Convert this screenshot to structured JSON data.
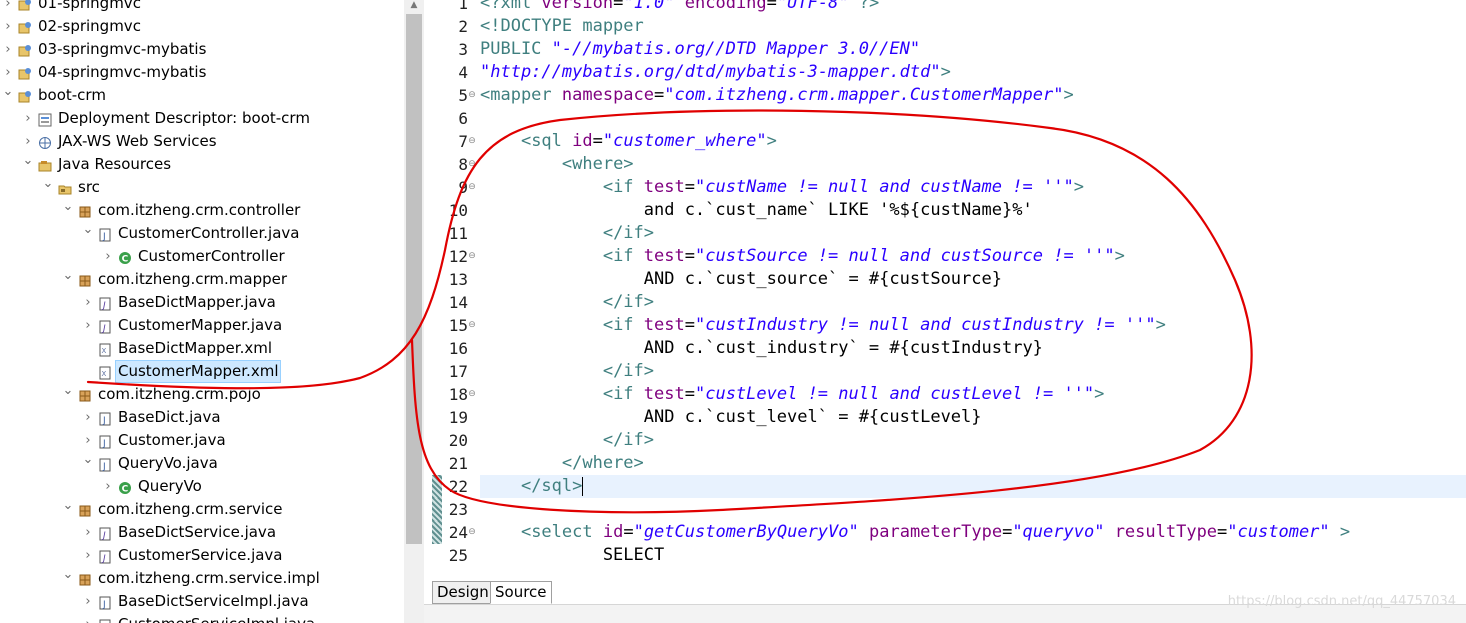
{
  "explorer": {
    "items": [
      {
        "label": "01-springmvc",
        "level": 0,
        "arrow": "collapsed",
        "icon": "web-project-icon"
      },
      {
        "label": "02-springmvc",
        "level": 0,
        "arrow": "collapsed",
        "icon": "web-project-icon"
      },
      {
        "label": "03-springmvc-mybatis",
        "level": 0,
        "arrow": "collapsed",
        "icon": "web-project-icon"
      },
      {
        "label": "04-springmvc-mybatis",
        "level": 0,
        "arrow": "collapsed",
        "icon": "web-project-icon"
      },
      {
        "label": "boot-crm",
        "level": 0,
        "arrow": "expanded",
        "icon": "web-project-icon"
      },
      {
        "label": "Deployment Descriptor: boot-crm",
        "level": 1,
        "arrow": "collapsed",
        "icon": "deployment-descriptor-icon"
      },
      {
        "label": "JAX-WS Web Services",
        "level": 1,
        "arrow": "collapsed",
        "icon": "web-services-icon"
      },
      {
        "label": "Java Resources",
        "level": 1,
        "arrow": "expanded",
        "icon": "java-resources-icon"
      },
      {
        "label": "src",
        "level": 2,
        "arrow": "expanded",
        "icon": "source-folder-icon"
      },
      {
        "label": "com.itzheng.crm.controller",
        "level": 3,
        "arrow": "expanded",
        "icon": "package-icon"
      },
      {
        "label": "CustomerController.java",
        "level": 4,
        "arrow": "expanded",
        "icon": "java-file-icon"
      },
      {
        "label": "CustomerController",
        "level": 5,
        "arrow": "collapsed",
        "icon": "class-icon"
      },
      {
        "label": "com.itzheng.crm.mapper",
        "level": 3,
        "arrow": "expanded",
        "icon": "package-icon"
      },
      {
        "label": "BaseDictMapper.java",
        "level": 4,
        "arrow": "collapsed",
        "icon": "java-interface-file-icon"
      },
      {
        "label": "CustomerMapper.java",
        "level": 4,
        "arrow": "collapsed",
        "icon": "java-interface-file-icon"
      },
      {
        "label": "BaseDictMapper.xml",
        "level": 4,
        "arrow": "none",
        "icon": "xml-file-icon"
      },
      {
        "label": "CustomerMapper.xml",
        "level": 4,
        "arrow": "none",
        "icon": "xml-file-icon",
        "selected": true
      },
      {
        "label": "com.itzheng.crm.pojo",
        "level": 3,
        "arrow": "expanded",
        "icon": "package-icon"
      },
      {
        "label": "BaseDict.java",
        "level": 4,
        "arrow": "collapsed",
        "icon": "java-file-icon"
      },
      {
        "label": "Customer.java",
        "level": 4,
        "arrow": "collapsed",
        "icon": "java-file-icon"
      },
      {
        "label": "QueryVo.java",
        "level": 4,
        "arrow": "expanded",
        "icon": "java-file-icon"
      },
      {
        "label": "QueryVo",
        "level": 5,
        "arrow": "collapsed",
        "icon": "class-icon"
      },
      {
        "label": "com.itzheng.crm.service",
        "level": 3,
        "arrow": "expanded",
        "icon": "package-icon"
      },
      {
        "label": "BaseDictService.java",
        "level": 4,
        "arrow": "collapsed",
        "icon": "java-interface-file-icon"
      },
      {
        "label": "CustomerService.java",
        "level": 4,
        "arrow": "collapsed",
        "icon": "java-interface-file-icon"
      },
      {
        "label": "com.itzheng.crm.service.impl",
        "level": 3,
        "arrow": "expanded",
        "icon": "package-icon"
      },
      {
        "label": "BaseDictServiceImpl.java",
        "level": 4,
        "arrow": "collapsed",
        "icon": "java-file-icon"
      },
      {
        "label": "CustomerServiceImpl.java",
        "level": 4,
        "arrow": "collapsed",
        "icon": "java-file-icon"
      }
    ]
  },
  "editor": {
    "current_line": 22,
    "annotated_lines": [
      22,
      23,
      24
    ],
    "lines": [
      {
        "num": "1",
        "fold": "",
        "tokens": [
          [
            "c-pi",
            "<?xml "
          ],
          [
            "c-attr",
            "version"
          ],
          [
            "c-plain",
            "="
          ],
          [
            "c-str",
            "\"1.0\""
          ],
          [
            "c-plain",
            " "
          ],
          [
            "c-attr",
            "encoding"
          ],
          [
            "c-plain",
            "="
          ],
          [
            "c-str",
            "\"UTF-8\""
          ],
          [
            "c-pi",
            " ?>"
          ]
        ]
      },
      {
        "num": "2",
        "fold": "",
        "tokens": [
          [
            "c-dt",
            "<!DOCTYPE mapper"
          ]
        ]
      },
      {
        "num": "3",
        "fold": "",
        "tokens": [
          [
            "c-dt",
            "PUBLIC "
          ],
          [
            "c-str",
            "\"-//mybatis.org//DTD Mapper 3.0//EN\""
          ]
        ]
      },
      {
        "num": "4",
        "fold": "",
        "tokens": [
          [
            "c-str",
            "\"http://mybatis.org/dtd/mybatis-3-mapper.dtd\""
          ],
          [
            "c-dt",
            ">"
          ]
        ]
      },
      {
        "num": "5",
        "fold": "⊖",
        "tokens": [
          [
            "c-tag",
            "<mapper "
          ],
          [
            "c-attr",
            "namespace"
          ],
          [
            "c-plain",
            "="
          ],
          [
            "c-str",
            "\"com.itzheng.crm.mapper.CustomerMapper\""
          ],
          [
            "c-tag",
            ">"
          ]
        ]
      },
      {
        "num": "6",
        "fold": "",
        "tokens": []
      },
      {
        "num": "7",
        "fold": "⊖",
        "tokens": [
          [
            "c-plain",
            "    "
          ],
          [
            "c-tag",
            "<sql "
          ],
          [
            "c-attr",
            "id"
          ],
          [
            "c-plain",
            "="
          ],
          [
            "c-str",
            "\"customer_where\""
          ],
          [
            "c-tag",
            ">"
          ]
        ]
      },
      {
        "num": "8",
        "fold": "⊖",
        "tokens": [
          [
            "c-plain",
            "        "
          ],
          [
            "c-tag",
            "<where>"
          ]
        ]
      },
      {
        "num": "9",
        "fold": "⊖",
        "tokens": [
          [
            "c-plain",
            "            "
          ],
          [
            "c-tag",
            "<if "
          ],
          [
            "c-attr",
            "test"
          ],
          [
            "c-plain",
            "="
          ],
          [
            "c-str",
            "\"custName != null and custName != ''\""
          ],
          [
            "c-tag",
            ">"
          ]
        ]
      },
      {
        "num": "10",
        "fold": "",
        "tokens": [
          [
            "c-text",
            "                and c.`cust_name` LIKE '%${custName}%'"
          ]
        ]
      },
      {
        "num": "11",
        "fold": "",
        "tokens": [
          [
            "c-plain",
            "            "
          ],
          [
            "c-tag",
            "</if>"
          ]
        ]
      },
      {
        "num": "12",
        "fold": "⊖",
        "tokens": [
          [
            "c-plain",
            "            "
          ],
          [
            "c-tag",
            "<if "
          ],
          [
            "c-attr",
            "test"
          ],
          [
            "c-plain",
            "="
          ],
          [
            "c-str",
            "\"custSource != null and custSource != ''\""
          ],
          [
            "c-tag",
            ">"
          ]
        ]
      },
      {
        "num": "13",
        "fold": "",
        "tokens": [
          [
            "c-text",
            "                AND c.`cust_source` = #{custSource}"
          ]
        ]
      },
      {
        "num": "14",
        "fold": "",
        "tokens": [
          [
            "c-plain",
            "            "
          ],
          [
            "c-tag",
            "</if>"
          ]
        ]
      },
      {
        "num": "15",
        "fold": "⊖",
        "tokens": [
          [
            "c-plain",
            "            "
          ],
          [
            "c-tag",
            "<if "
          ],
          [
            "c-attr",
            "test"
          ],
          [
            "c-plain",
            "="
          ],
          [
            "c-str",
            "\"custIndustry != null and custIndustry != ''\""
          ],
          [
            "c-tag",
            ">"
          ]
        ]
      },
      {
        "num": "16",
        "fold": "",
        "tokens": [
          [
            "c-text",
            "                AND c.`cust_industry` = #{custIndustry}"
          ]
        ]
      },
      {
        "num": "17",
        "fold": "",
        "tokens": [
          [
            "c-plain",
            "            "
          ],
          [
            "c-tag",
            "</if>"
          ]
        ]
      },
      {
        "num": "18",
        "fold": "⊖",
        "tokens": [
          [
            "c-plain",
            "            "
          ],
          [
            "c-tag",
            "<if "
          ],
          [
            "c-attr",
            "test"
          ],
          [
            "c-plain",
            "="
          ],
          [
            "c-str",
            "\"custLevel != null and custLevel != ''\""
          ],
          [
            "c-tag",
            ">"
          ]
        ]
      },
      {
        "num": "19",
        "fold": "",
        "tokens": [
          [
            "c-text",
            "                AND c.`cust_level` = #{custLevel}"
          ]
        ]
      },
      {
        "num": "20",
        "fold": "",
        "tokens": [
          [
            "c-plain",
            "            "
          ],
          [
            "c-tag",
            "</if>"
          ]
        ]
      },
      {
        "num": "21",
        "fold": "",
        "tokens": [
          [
            "c-plain",
            "        "
          ],
          [
            "c-tag",
            "</where>"
          ]
        ]
      },
      {
        "num": "22",
        "fold": "",
        "tokens": [
          [
            "c-plain",
            "    "
          ],
          [
            "c-tag",
            "</sql>"
          ]
        ],
        "cursor": true
      },
      {
        "num": "23",
        "fold": "",
        "tokens": []
      },
      {
        "num": "24",
        "fold": "⊖",
        "tokens": [
          [
            "c-plain",
            "    "
          ],
          [
            "c-tag",
            "<select "
          ],
          [
            "c-attr",
            "id"
          ],
          [
            "c-plain",
            "="
          ],
          [
            "c-str",
            "\"getCustomerByQueryVo\""
          ],
          [
            "c-plain",
            " "
          ],
          [
            "c-attr",
            "parameterType"
          ],
          [
            "c-plain",
            "="
          ],
          [
            "c-str",
            "\"queryvo\""
          ],
          [
            "c-plain",
            " "
          ],
          [
            "c-attr",
            "resultType"
          ],
          [
            "c-plain",
            "="
          ],
          [
            "c-str",
            "\"customer\""
          ],
          [
            "c-tag",
            " >"
          ]
        ]
      },
      {
        "num": "25",
        "fold": "",
        "tokens": [
          [
            "c-text",
            "            SELECT"
          ]
        ]
      }
    ],
    "tabs": [
      {
        "label": "Design",
        "active": false
      },
      {
        "label": "Source",
        "active": true
      }
    ]
  },
  "watermark": "https://blog.csdn.net/qq_44757034",
  "colors": {
    "tag": "#3f7f7f",
    "attribute": "#7f007f",
    "string": "#2a00ff",
    "text": "#000000",
    "selection": "#cde8ff",
    "current_line": "#e8f2fe",
    "annotation_ink": "#e00000"
  }
}
